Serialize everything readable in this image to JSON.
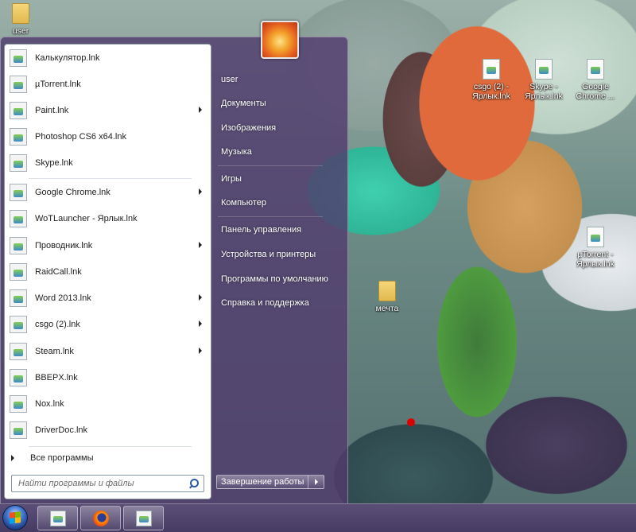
{
  "desktop": {
    "icons": [
      {
        "label": "user",
        "icon": "folder-icon"
      },
      {
        "label": "csgo (2) - Ярлык.lnk",
        "icon": "shortcut-icon"
      },
      {
        "label": "Skype - Ярлык.lnk",
        "icon": "shortcut-icon"
      },
      {
        "label": "Google Chrome ...",
        "icon": "shortcut-icon"
      },
      {
        "label": "µTorrent - Ярлык.lnk",
        "icon": "shortcut-icon"
      },
      {
        "label": "мечта",
        "icon": "folder-icon"
      }
    ]
  },
  "start_menu": {
    "pinned": [
      {
        "label": "Калькулятор.lnk",
        "submenu": false
      },
      {
        "label": "µTorrent.lnk",
        "submenu": false
      },
      {
        "label": "Paint.lnk",
        "submenu": true
      },
      {
        "label": "Photoshop CS6 x64.lnk",
        "submenu": false
      },
      {
        "label": "Skype.lnk",
        "submenu": false
      }
    ],
    "recent": [
      {
        "label": "Google Chrome.lnk",
        "submenu": true
      },
      {
        "label": "WoTLauncher - Ярлык.lnk",
        "submenu": false
      },
      {
        "label": "Проводник.lnk",
        "submenu": true
      },
      {
        "label": "RaidCall.lnk",
        "submenu": false
      },
      {
        "label": "Word 2013.lnk",
        "submenu": true
      },
      {
        "label": "csgo (2).lnk",
        "submenu": true
      },
      {
        "label": "Steam.lnk",
        "submenu": true
      },
      {
        "label": "BBEPX.lnk",
        "submenu": false
      },
      {
        "label": "Nox.lnk",
        "submenu": false
      },
      {
        "label": "DriverDoc.lnk",
        "submenu": false
      }
    ],
    "all_programs_label": "Все программы",
    "search_placeholder": "Найти программы и файлы",
    "right_items": [
      "user",
      "Документы",
      "Изображения",
      "Музыка",
      "Игры",
      "Компьютер",
      "Панель управления",
      "Устройства и принтеры",
      "Программы по умолчанию",
      "Справка и поддержка"
    ],
    "shutdown_label": "Завершение работы"
  },
  "taskbar": {
    "pinned": [
      {
        "icon": "file-icon"
      },
      {
        "icon": "firefox-icon"
      },
      {
        "icon": "file-icon"
      }
    ]
  }
}
